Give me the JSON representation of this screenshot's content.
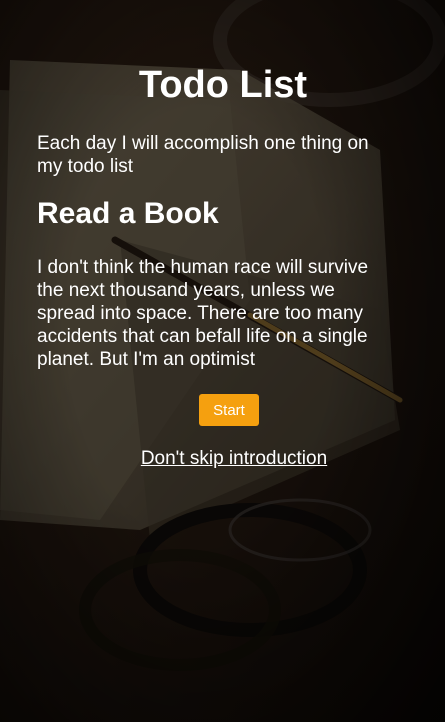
{
  "app": {
    "title": "Todo List",
    "subtitle": "Each day I will accomplish one thing on my todo list"
  },
  "task": {
    "title": "Read a Book",
    "description": "I don't think the human race will survive the next thousand years, unless we spread into space. There are too many accidents that can befall life on a single planet. But I'm an optimist"
  },
  "actions": {
    "start_label": "Start",
    "skip_label": "Don't skip introduction"
  },
  "colors": {
    "accent": "#f5a00f",
    "text": "#ffffff"
  }
}
